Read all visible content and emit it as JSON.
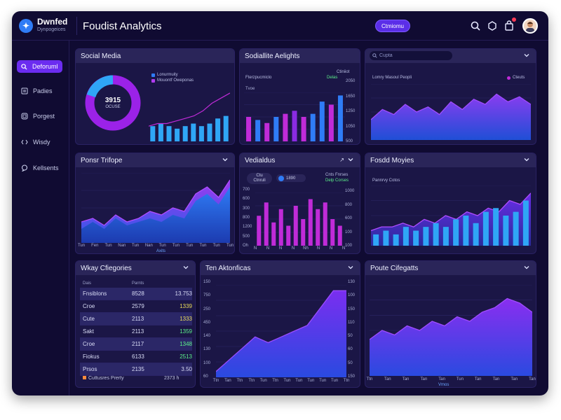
{
  "header": {
    "brand": "Dwnfed",
    "brand_sub": "Dynpogeices",
    "title": "Foudist Analytics",
    "pill_button": "Ctmiomu",
    "icons": [
      "search-icon",
      "settings-icon",
      "bag-icon",
      "avatar"
    ]
  },
  "sidebar": {
    "items": [
      {
        "label": "Deforuml",
        "icon": "search-icon",
        "active": true
      },
      {
        "label": "Padies",
        "icon": "document-icon",
        "active": false
      },
      {
        "label": "Porgest",
        "icon": "grid-icon",
        "active": false
      },
      {
        "label": "Wisdy",
        "icon": "code-icon",
        "active": false
      },
      {
        "label": "Kellsents",
        "icon": "chat-icon",
        "active": false
      }
    ]
  },
  "panels": {
    "social_media": {
      "title": "Social Media",
      "donut_value": "3915",
      "donut_sub": "OCUSE",
      "legend": [
        {
          "label": "Lonurmuity",
          "color": "#2f7cf6"
        },
        {
          "label": "Mouontf Oweponas",
          "color": "#b13cf0"
        }
      ],
      "chart_data": {
        "type": "bar",
        "values": [
          6,
          7,
          6,
          5,
          6,
          7,
          6,
          7,
          9,
          10
        ],
        "line": [
          6,
          7,
          7,
          8,
          9,
          10,
          12,
          15,
          17,
          19
        ],
        "ylim": [
          0,
          22
        ]
      }
    },
    "social_insights": {
      "title": "Sodiallite Aelights",
      "legend_left": "Fterzpucmiclo",
      "legend_right_1": "Ctiniiot",
      "legend_right_2": "Delas",
      "y_label_left": "Tvoe",
      "right_ticks": [
        "2050",
        "1650",
        "1250",
        "1050",
        "500"
      ],
      "chart_data": {
        "type": "bar",
        "values": [
          8,
          7,
          6,
          8,
          9,
          10,
          8,
          9,
          13,
          12,
          15
        ],
        "colors": [
          "#c02bd8",
          "#2f7cf6",
          "#c02bd8",
          "#2f7cf6",
          "#c02bd8",
          "#8a2be2",
          "#c02bd8",
          "#2f7cf6",
          "#2f7cf6",
          "#c02bd8",
          "#2f7cf6"
        ],
        "ylim": [
          0,
          16
        ]
      }
    },
    "top_right": {
      "search_placeholder": "Cupta",
      "legend_left": "Lomry Masoul Peopli",
      "legend_right": "Cteuts",
      "chart_data": {
        "type": "area",
        "values": [
          8,
          12,
          10,
          14,
          11,
          13,
          10,
          15,
          12,
          16,
          14,
          18,
          15,
          17,
          14
        ],
        "ylim": [
          0,
          22
        ]
      }
    },
    "ponsr_trifope": {
      "title": "Ponsr Trifope",
      "x_ticks": [
        "Tun",
        "Fen",
        "Tun",
        "Nan",
        "Tun",
        "Nan",
        "Tun",
        "Tun",
        "Tun",
        "Tun",
        "Tun",
        "Tun"
      ],
      "x_caption": "Axits",
      "chart_data": {
        "type": "area",
        "series_a": [
          6,
          7,
          5,
          8,
          6,
          7,
          9,
          8,
          10,
          9,
          14,
          16,
          13,
          18
        ],
        "series_b": [
          4,
          6,
          4,
          7,
          5,
          6,
          7,
          6,
          8,
          7,
          12,
          14,
          11,
          16
        ],
        "ylim": [
          0,
          20
        ]
      }
    },
    "vedialdus": {
      "title": "Vedialdus",
      "controls": [
        "Ctu",
        "Ctnruli",
        "1890"
      ],
      "legend_1": "Cnts Fnrses",
      "legend_2": "Delp Corses",
      "y_ticks": [
        "700",
        "600",
        "300",
        "800",
        "1200",
        "500",
        "Oh"
      ],
      "right_ticks": [
        "1000",
        "800",
        "600",
        "100",
        "100"
      ],
      "x_ticks": [
        "N",
        "N",
        "N",
        "N",
        "Nh",
        "N",
        "N",
        "N"
      ],
      "chart_data": {
        "type": "bar",
        "values": [
          9,
          13,
          7,
          11,
          6,
          12,
          8,
          14,
          11,
          13,
          8,
          6
        ],
        "colors": [
          "#c02bd8",
          "#c02bd8",
          "#c02bd8",
          "#c02bd8",
          "#c02bd8",
          "#c02bd8",
          "#c02bd8",
          "#c02bd8",
          "#c02bd8",
          "#c02bd8",
          "#c02bd8",
          "#c02bd8"
        ],
        "ylim": [
          0,
          16
        ]
      }
    },
    "fosdd_moyies": {
      "title": "Fosdd Moyies",
      "legend_top": "Pannrvy Cotos",
      "chart_data": {
        "type": "area",
        "bars": [
          3,
          4,
          3,
          5,
          4,
          5,
          6,
          5,
          7,
          8,
          6,
          9,
          10,
          8,
          9,
          12
        ],
        "line": [
          4,
          5,
          5,
          6,
          5,
          7,
          6,
          8,
          7,
          9,
          8,
          10,
          9,
          12,
          11,
          14
        ],
        "ylim": [
          0,
          16
        ]
      }
    },
    "wkay_cfiegories": {
      "title": "Wkay Cfiegories",
      "headers": [
        "Dais",
        "Parnts",
        ""
      ],
      "rows": [
        {
          "name": "Fnsiblons",
          "v1": "8528",
          "v2": "13.753",
          "color": "plain"
        },
        {
          "name": "Croe",
          "v1": "2579",
          "v2": "1339",
          "color": "y"
        },
        {
          "name": "Cute",
          "v1": "2113",
          "v2": "1333",
          "color": "y"
        },
        {
          "name": "Sakt",
          "v1": "2113",
          "v2": "1359",
          "color": "g"
        },
        {
          "name": "Croe",
          "v1": "2117",
          "v2": "1348",
          "color": "g"
        },
        {
          "name": "Fiokus",
          "v1": "6133",
          "v2": "2513",
          "color": "g"
        },
        {
          "name": "Prsos",
          "v1": "2135",
          "v2": "3.50",
          "color": "plain"
        }
      ],
      "footer_left": "Cuttusres Prerty",
      "footer_right": "2373 h"
    },
    "ten_aktonficas": {
      "title": "Ten Aktonficas",
      "y_ticks": [
        "150",
        "750",
        "250",
        "450",
        "140",
        "130",
        "100",
        "60"
      ],
      "right_ticks": [
        "130",
        "100",
        "150",
        "110",
        "50",
        "60",
        "50",
        "150"
      ],
      "x_ticks": [
        "Ttn",
        "Tan",
        "Ttn",
        "Ttn",
        "Tun",
        "Ttn",
        "Tun",
        "Tun",
        "Tun",
        "Tun",
        "Tun",
        "Ttn"
      ],
      "chart_data": {
        "type": "area",
        "values": [
          1,
          3,
          5,
          7,
          6,
          7,
          8,
          9,
          12,
          15,
          15
        ],
        "ylim": [
          0,
          16
        ]
      }
    },
    "poute_cifegatts": {
      "title": "Poute Cifegatts",
      "x_ticks": [
        "Ttn",
        "Tan",
        "Tan",
        "Tan",
        "Tan",
        "Tun",
        "Tan",
        "Tan",
        "Tan",
        "Tan"
      ],
      "x_caption": "Vmos",
      "chart_data": {
        "type": "area",
        "values": [
          8,
          10,
          9,
          11,
          10,
          12,
          11,
          13,
          12,
          14,
          15,
          17,
          16,
          14
        ],
        "ylim": [
          0,
          20
        ]
      }
    }
  }
}
